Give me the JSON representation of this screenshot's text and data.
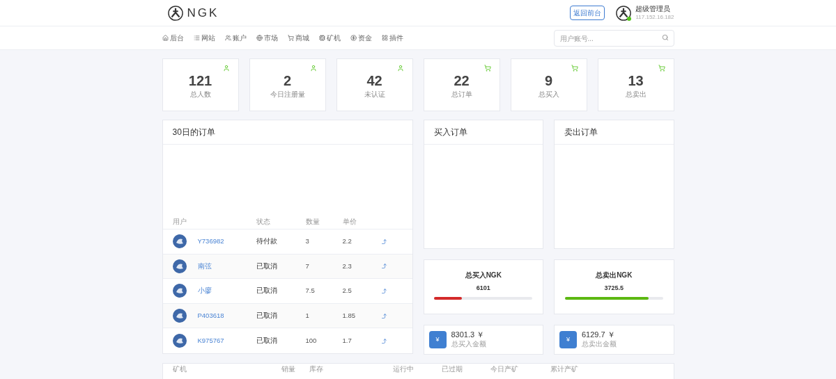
{
  "header": {
    "logo_text": "NGK",
    "back_button": "返回前台",
    "user": {
      "name": "超级管理员",
      "ip": "117.152.16.182",
      "online": true
    }
  },
  "nav": {
    "items": [
      {
        "label": "后台"
      },
      {
        "label": "网站"
      },
      {
        "label": "账户"
      },
      {
        "label": "市场"
      },
      {
        "label": "商城"
      },
      {
        "label": "矿机"
      },
      {
        "label": "资金"
      },
      {
        "label": "插件"
      }
    ],
    "search": {
      "placeholder": "用户账号..."
    }
  },
  "stats": [
    {
      "value": "121",
      "label": "总人数",
      "kind": "user"
    },
    {
      "value": "2",
      "label": "今日注册量",
      "kind": "user"
    },
    {
      "value": "42",
      "label": "未认证",
      "kind": "user"
    },
    {
      "value": "22",
      "label": "总订单",
      "kind": "order"
    },
    {
      "value": "9",
      "label": "总买入",
      "kind": "order"
    },
    {
      "value": "13",
      "label": "总卖出",
      "kind": "order"
    }
  ],
  "orders": {
    "title": "30日的订单",
    "columns": [
      "用户",
      "状态",
      "数量",
      "单价"
    ],
    "rows": [
      {
        "user": "Y736982",
        "status": "待付款",
        "qty": "3",
        "price": "2.2"
      },
      {
        "user": "南弦",
        "status": "已取消",
        "qty": "7",
        "price": "2.3"
      },
      {
        "user": "小廖",
        "status": "已取消",
        "qty": "7.5",
        "price": "2.5"
      },
      {
        "user": "P403618",
        "status": "已取消",
        "qty": "1",
        "price": "1.85"
      },
      {
        "user": "K975767",
        "status": "已取消",
        "qty": "100",
        "price": "1.7"
      }
    ]
  },
  "buy_orders": {
    "title": "买入订单"
  },
  "sell_orders": {
    "title": "卖出订单"
  },
  "totals": [
    {
      "title": "总买入NGK",
      "value": "6101",
      "level": 0.28,
      "color": "#d42a2a"
    },
    {
      "title": "总卖出NGK",
      "value": "3725.5",
      "level": 0.85,
      "color": "#5cb811"
    }
  ],
  "amounts": [
    {
      "symbol": "¥",
      "value": "8301.3 ￥",
      "label": "总买入金额"
    },
    {
      "symbol": "¥",
      "value": "6129.7 ￥",
      "label": "总卖出金额"
    }
  ],
  "miners": {
    "columns": [
      "矿机",
      "销量",
      "库存",
      "运行中",
      "已过期",
      "今日产矿",
      "累计产矿"
    ]
  }
}
